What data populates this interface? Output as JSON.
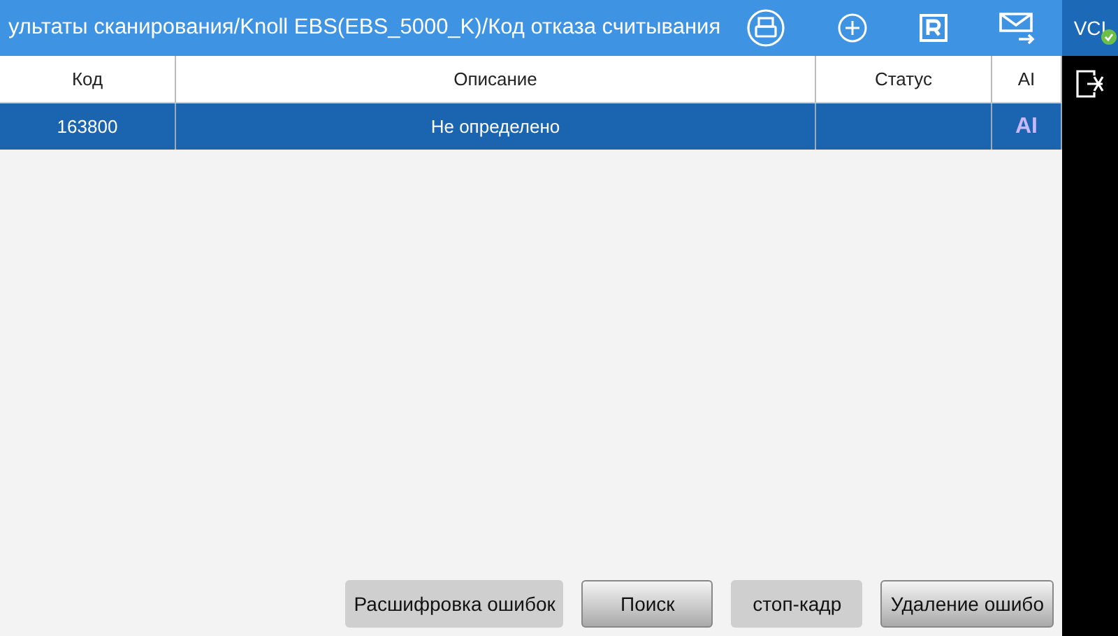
{
  "header": {
    "title": "ультаты сканирования/Knoll EBS(EBS_5000_K)/Код отказа считывания"
  },
  "side": {
    "vci": "VCI",
    "connected": true
  },
  "table": {
    "columns": [
      "Код",
      "Описание",
      "Статус",
      "AI"
    ],
    "rows": [
      {
        "code": "163800",
        "description": "Не определено",
        "status": "",
        "ai": "AI",
        "selected": true
      }
    ]
  },
  "buttons": [
    {
      "label": "Расшифровка ошибок",
      "kind": "flat"
    },
    {
      "label": "Поиск",
      "kind": "raised"
    },
    {
      "label": "стоп-кадр",
      "kind": "flat"
    },
    {
      "label": "Удаление ошибо",
      "kind": "raised"
    }
  ]
}
